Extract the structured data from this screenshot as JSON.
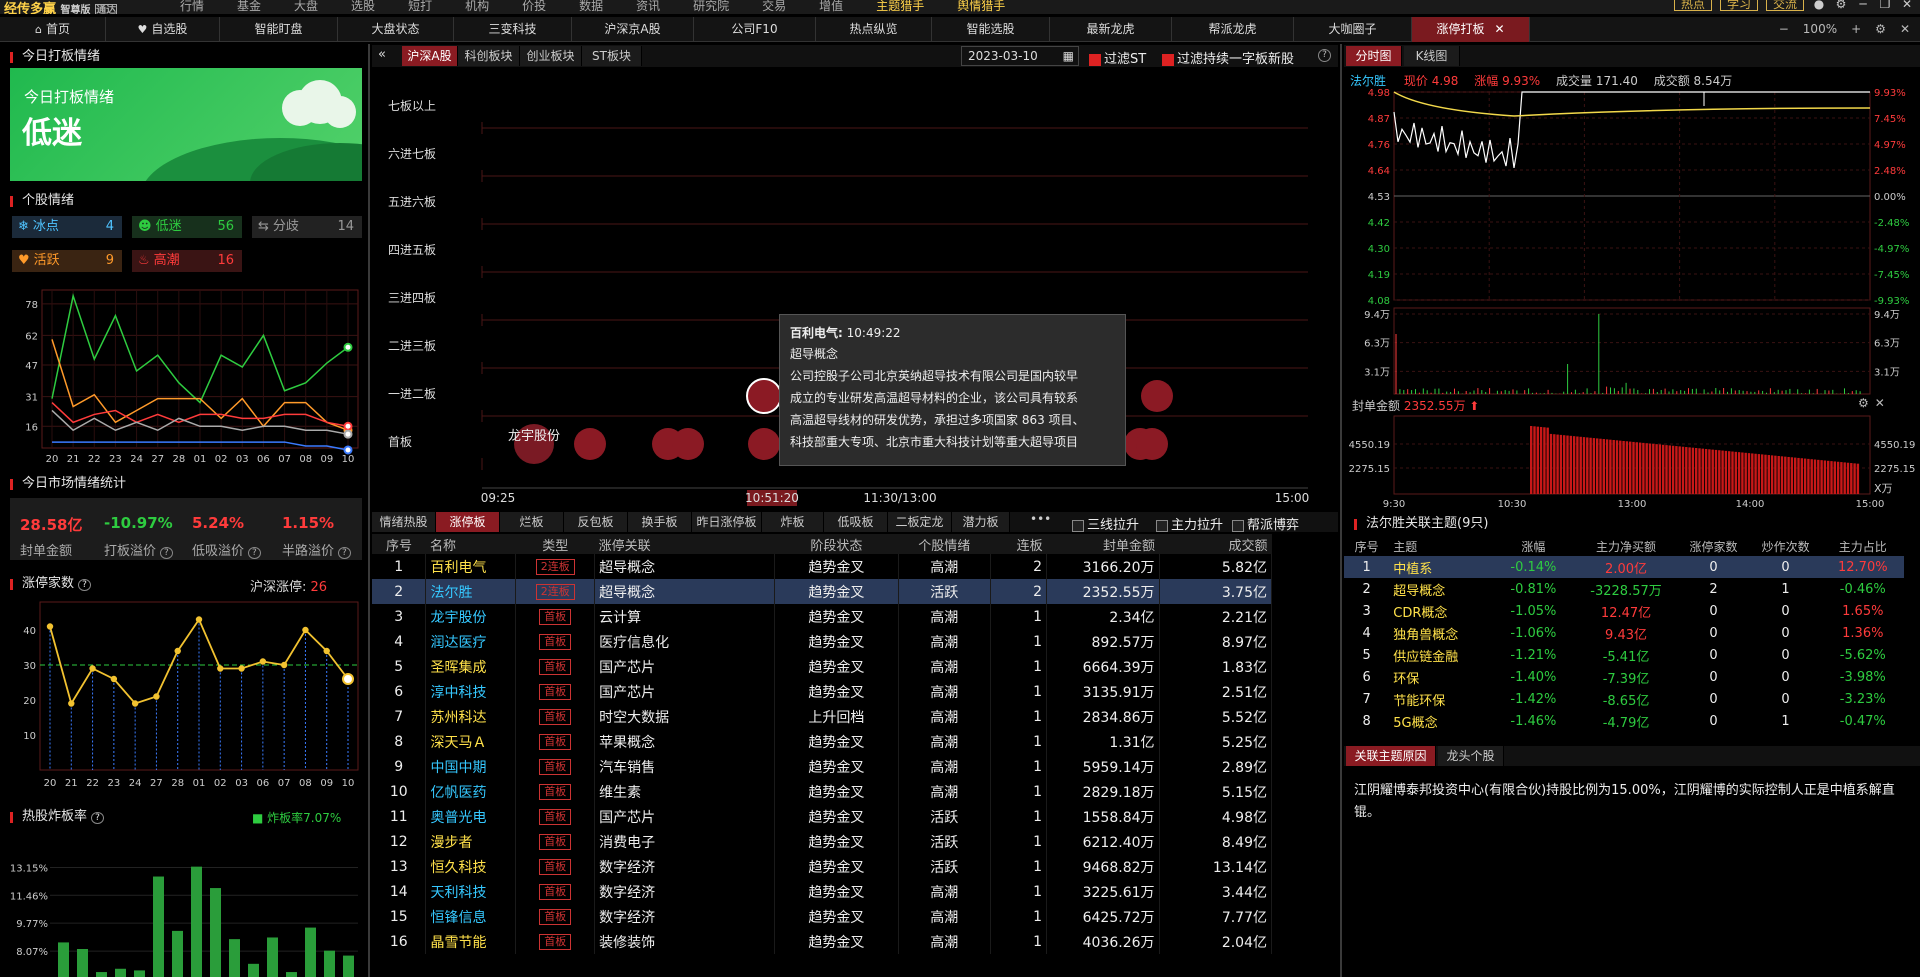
{
  "app": {
    "logo": "经传多赢",
    "edition": "智尊版",
    "tag": "通达"
  },
  "menu": [
    "行情",
    "基金",
    "大盘",
    "选股",
    "短打",
    "机构",
    "价投",
    "数据",
    "资讯",
    "研究院",
    "交易",
    "增值",
    "主题猎手",
    "舆情猎手"
  ],
  "top_right": [
    "热点",
    "学习",
    "交流"
  ],
  "tabs": [
    {
      "label": "首页",
      "icon": "home-icon"
    },
    {
      "label": "自选股",
      "icon": "heart-icon"
    },
    {
      "label": "智能盯盘"
    },
    {
      "label": "大盘状态"
    },
    {
      "label": "三变科技"
    },
    {
      "label": "沪深京A股"
    },
    {
      "label": "公司F10"
    },
    {
      "label": "热点纵览"
    },
    {
      "label": "智能选股"
    },
    {
      "label": "最新龙虎"
    },
    {
      "label": "帮派龙虎"
    },
    {
      "label": "大咖圈子"
    },
    {
      "label": "涨停打板",
      "active": true
    }
  ],
  "zoom": "100%",
  "left": {
    "today_title": "今日打板情绪",
    "banner_sub": "今日打板情绪",
    "banner_main": "低迷",
    "stock_mood_title": "个股情绪",
    "moods": [
      {
        "label": "冰点",
        "value": "4",
        "icon": "snowflake-icon"
      },
      {
        "label": "低迷",
        "value": "56",
        "icon": "smile-icon"
      },
      {
        "label": "分歧",
        "value": "14",
        "icon": "share-icon"
      },
      {
        "label": "活跃",
        "value": "9",
        "icon": "heart-icon"
      },
      {
        "label": "高潮",
        "value": "16",
        "icon": "flame-icon"
      }
    ],
    "mood_chart_yticks": [
      "78",
      "62",
      "47",
      "31",
      "16"
    ],
    "mood_chart_xticks": [
      "20",
      "21",
      "22",
      "23",
      "24",
      "27",
      "28",
      "01",
      "02",
      "03",
      "06",
      "07",
      "08",
      "09",
      "10"
    ],
    "market_title": "今日市场情绪统计",
    "stats": [
      {
        "value": "28.58亿",
        "label": "封单金额"
      },
      {
        "value": "-10.97%",
        "label": "打板溢价"
      },
      {
        "value": "5.24%",
        "label": "低吸溢价"
      },
      {
        "value": "1.15%",
        "label": "半路溢价"
      }
    ],
    "limit_count_title": "涨停家数",
    "limit_count_label": "沪深涨停:",
    "limit_count_value": "26",
    "count_yticks": [
      "40",
      "30",
      "20",
      "10"
    ],
    "hot_title": "热股炸板率",
    "hot_legend": "炸板率7.07%",
    "hot_yticks": [
      "13.15%",
      "11.46%",
      "9.77%",
      "8.07%"
    ]
  },
  "center": {
    "subtabs": [
      "沪深A股",
      "科创板块",
      "创业板块",
      "ST板块"
    ],
    "date": "2023-03-10",
    "filter_st": "过滤ST",
    "filter_one": "过滤持续一字板新股",
    "levels": [
      "七板以上",
      "六进七板",
      "五进六板",
      "四进五板",
      "三进四板",
      "二进三板",
      "一进二板",
      "首板"
    ],
    "times": [
      "09:25",
      "10:51:20",
      "11:30/13:00",
      "15:00"
    ],
    "bubble_label": "龙宇股份",
    "tooltip": {
      "title": "百利电气:",
      "time": "10:49:22",
      "concept": "超导概念",
      "lines": [
        "公司控股子公司北京英纳超导技术有限公司是国内较早",
        "成立的专业研发高温超导材料的企业，该公司具有较系",
        "高温超导线材的研发优势，承担过多项国家 863 项目、",
        "科技部重大专项、北京市重大科技计划等重大超导项目"
      ]
    },
    "bottom_tabs": [
      "情绪热股",
      "涨停板",
      "烂板",
      "反包板",
      "换手板",
      "昨日涨停板",
      "炸板",
      "低吸板",
      "二板定龙",
      "潜力板"
    ],
    "checks": [
      "三线拉升",
      "主力拉升",
      "帮派博弈"
    ],
    "headers": [
      "序号",
      "名称",
      "类型",
      "涨停关联",
      "阶段状态",
      "个股情绪",
      "连板",
      "封单金额",
      "成交额"
    ],
    "rows": [
      [
        "1",
        "百利电气",
        "2连板",
        "超导概念",
        "趋势金叉",
        "高潮",
        "2",
        "3166.20万",
        "5.82亿"
      ],
      [
        "2",
        "法尔胜",
        "2连板",
        "超导概念",
        "趋势金叉",
        "活跃",
        "2",
        "2352.55万",
        "3.75亿"
      ],
      [
        "3",
        "龙宇股份",
        "首板",
        "云计算",
        "趋势金叉",
        "高潮",
        "1",
        "2.34亿",
        "2.21亿"
      ],
      [
        "4",
        "润达医疗",
        "首板",
        "医疗信息化",
        "趋势金叉",
        "高潮",
        "1",
        "892.57万",
        "8.97亿"
      ],
      [
        "5",
        "圣晖集成",
        "首板",
        "国产芯片",
        "趋势金叉",
        "高潮",
        "1",
        "6664.39万",
        "1.83亿"
      ],
      [
        "6",
        "淳中科技",
        "首板",
        "国产芯片",
        "趋势金叉",
        "高潮",
        "1",
        "3135.91万",
        "2.51亿"
      ],
      [
        "7",
        "苏州科达",
        "首板",
        "时空大数据",
        "上升回档",
        "高潮",
        "1",
        "2834.86万",
        "5.52亿"
      ],
      [
        "8",
        "深天马Ａ",
        "首板",
        "苹果概念",
        "趋势金叉",
        "高潮",
        "1",
        "1.31亿",
        "5.25亿"
      ],
      [
        "9",
        "中国中期",
        "首板",
        "汽车销售",
        "趋势金叉",
        "高潮",
        "1",
        "5959.14万",
        "2.89亿"
      ],
      [
        "10",
        "亿帆医药",
        "首板",
        "维生素",
        "趋势金叉",
        "高潮",
        "1",
        "2829.18万",
        "5.15亿"
      ],
      [
        "11",
        "奥普光电",
        "首板",
        "国产芯片",
        "趋势金叉",
        "活跃",
        "1",
        "1558.84万",
        "4.98亿"
      ],
      [
        "12",
        "漫步者",
        "首板",
        "消费电子",
        "趋势金叉",
        "活跃",
        "1",
        "6212.40万",
        "8.49亿"
      ],
      [
        "13",
        "恒久科技",
        "首板",
        "数字经济",
        "趋势金叉",
        "活跃",
        "1",
        "9468.82万",
        "13.14亿"
      ],
      [
        "14",
        "天利科技",
        "首板",
        "数字经济",
        "趋势金叉",
        "高潮",
        "1",
        "3225.61万",
        "3.44亿"
      ],
      [
        "15",
        "恒锋信息",
        "首板",
        "数字经济",
        "趋势金叉",
        "高潮",
        "1",
        "6425.72万",
        "7.77亿"
      ],
      [
        "16",
        "晶雪节能",
        "首板",
        "装修装饰",
        "趋势金叉",
        "高潮",
        "1",
        "4036.26万",
        "2.04亿"
      ]
    ]
  },
  "right": {
    "tabs": [
      "分时图",
      "K线图"
    ],
    "stock": "法尔胜",
    "price_label": "现价",
    "price": "4.98",
    "chg_label": "涨幅",
    "chg": "9.93%",
    "vol_label": "成交量",
    "vol": "171.40",
    "amt_label": "成交额",
    "amt": "8.54万",
    "price_ticks": [
      "4.98",
      "4.87",
      "4.76",
      "4.64",
      "4.53",
      "4.42",
      "4.30",
      "4.19",
      "4.08"
    ],
    "pct_ticks": [
      "9.93%",
      "7.45%",
      "4.97%",
      "2.48%",
      "0.00%",
      "-2.48%",
      "-4.97%",
      "-7.45%",
      "-9.93%"
    ],
    "vol_ticks": [
      "9.4万",
      "6.3万",
      "3.1万"
    ],
    "seal_label": "封单金额",
    "seal_value": "2352.55万",
    "seal_ticks": [
      "4550.19",
      "2275.15"
    ],
    "seal_unit": "X万",
    "time_ticks": [
      "9:30",
      "10:30",
      "13:00",
      "14:00",
      "15:00"
    ],
    "related_title": "法尔胜关联主题(9只)",
    "related_headers": [
      "序号",
      "主题",
      "涨幅",
      "主力净买额",
      "涨停家数",
      "炒作次数",
      "主力占比"
    ],
    "related_rows": [
      [
        "1",
        "中植系",
        "-0.14%",
        "2.00亿",
        "0",
        "0",
        "12.70%"
      ],
      [
        "2",
        "超导概念",
        "-0.81%",
        "-3228.57万",
        "2",
        "1",
        "-0.46%"
      ],
      [
        "3",
        "CDR概念",
        "-1.05%",
        "12.47亿",
        "0",
        "0",
        "1.65%"
      ],
      [
        "4",
        "独角兽概念",
        "-1.06%",
        "9.43亿",
        "0",
        "0",
        "1.36%"
      ],
      [
        "5",
        "供应链金融",
        "-1.21%",
        "-5.41亿",
        "0",
        "0",
        "-5.62%"
      ],
      [
        "6",
        "环保",
        "-1.40%",
        "-7.39亿",
        "0",
        "0",
        "-3.98%"
      ],
      [
        "7",
        "节能环保",
        "-1.42%",
        "-8.65亿",
        "0",
        "0",
        "-3.23%"
      ],
      [
        "8",
        "5G概念",
        "-1.46%",
        "-4.79亿",
        "0",
        "1",
        "-0.47%"
      ]
    ],
    "reason_tabs": [
      "关联主题原因",
      "龙头个股"
    ],
    "reason_text": "江阴耀博泰邦投资中心(有限合伙)持股比例为15.00%，江阴耀博的实际控制人正是中植系解直锟。"
  }
}
